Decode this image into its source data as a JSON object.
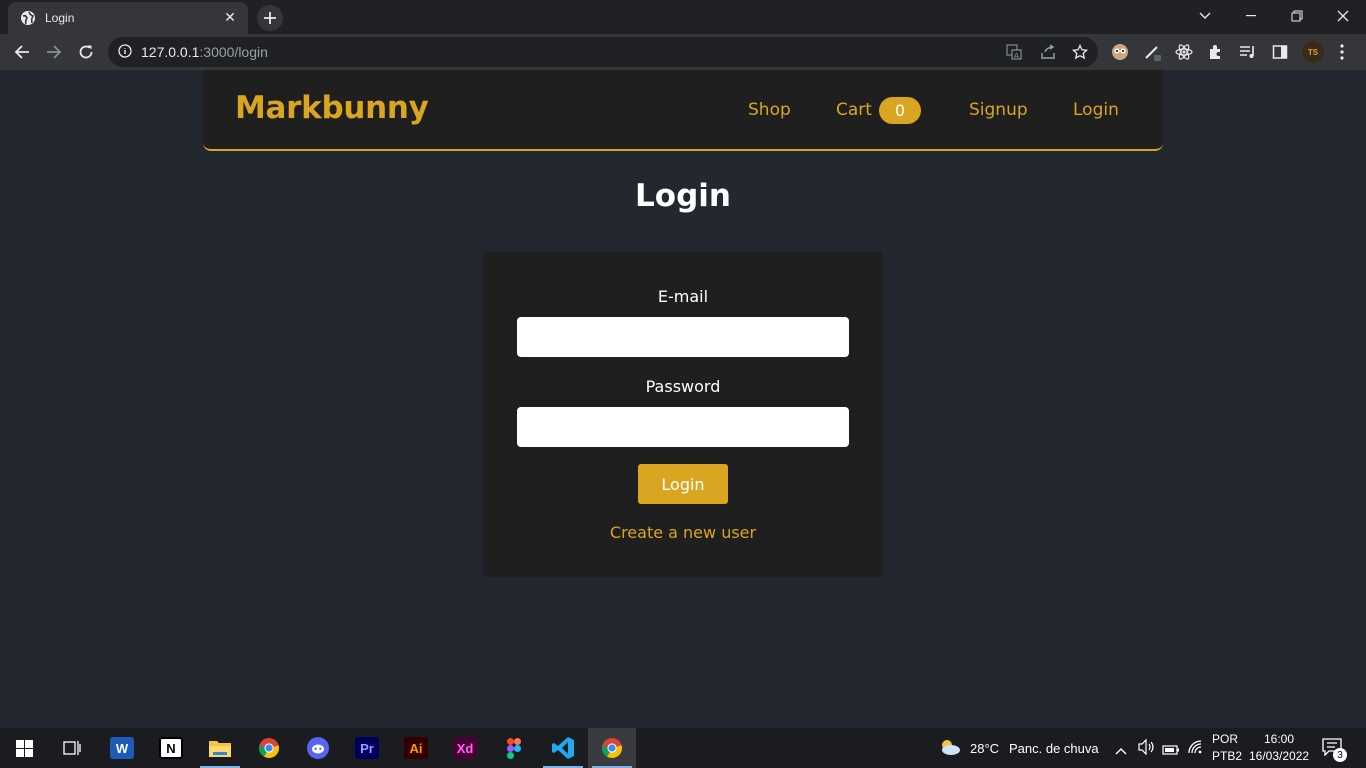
{
  "browser": {
    "tab_title": "Login",
    "url_host": "127.0.0.1",
    "url_path": ":3000/login",
    "ext_badge": "TS"
  },
  "site": {
    "brand": "Markbunny",
    "nav": {
      "shop": "Shop",
      "cart": "Cart",
      "cart_count": "0",
      "signup": "Signup",
      "login": "Login"
    },
    "page_title": "Login",
    "form": {
      "email_label": "E-mail",
      "email_value": "",
      "password_label": "Password",
      "password_value": "",
      "submit_label": "Login",
      "create_link": "Create a new user"
    },
    "colors": {
      "accent": "#daa520",
      "bg": "#23272f",
      "card": "#1f1f1f"
    }
  },
  "taskbar": {
    "apps": [
      "windows-start-icon",
      "task-view-icon",
      "word-icon",
      "notion-icon",
      "file-explorer-icon",
      "chrome-icon",
      "discord-icon",
      "premiere-icon",
      "illustrator-icon",
      "xd-icon",
      "figma-icon",
      "vscode-icon",
      "chrome-active-icon"
    ],
    "app_glyphs": {
      "word": "W",
      "notion": "N",
      "premiere": "Pr",
      "illustrator": "Ai",
      "xd": "Xd"
    },
    "weather_temp": "28°C",
    "weather_text": "Panc. de chuva",
    "lang_top": "POR",
    "lang_bottom": "PTB2",
    "time": "16:00",
    "date": "16/03/2022",
    "notifications": "3"
  }
}
